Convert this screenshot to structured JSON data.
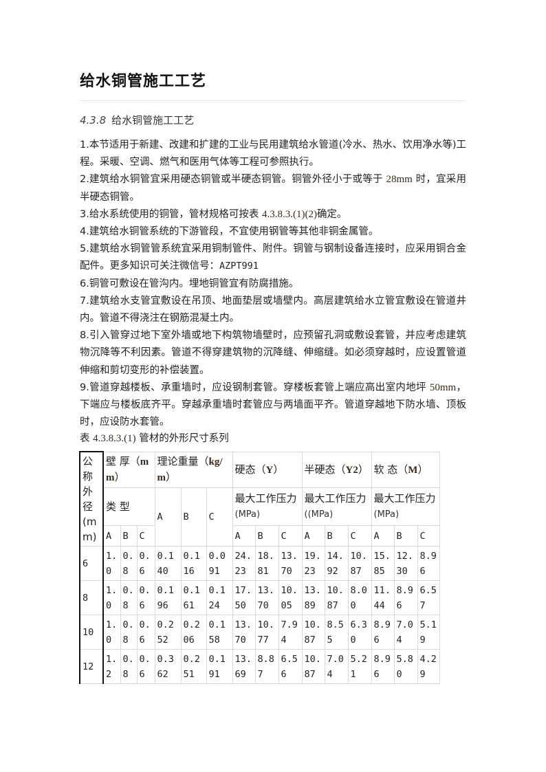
{
  "document": {
    "title": "给水铜管施工工艺",
    "section_number": "4.3.8",
    "section_title": "给水铜管施工工艺",
    "paragraphs": [
      {
        "prefix": "1.",
        "text": "本节适用于新建、改建和扩建的工业与民用建筑给水管道(冷水、热水、饮用净水等)工程。采暖、空调、燃气和医用气体等工程可参照执行。"
      },
      {
        "prefix": "2.",
        "text_a": "建筑给水铜管宜采用硬态铜管或半硬态铜管。铜管外径小于或等于 ",
        "latin": "28mm",
        "text_b": " 时，宜采用半硬态铜管。"
      },
      {
        "prefix": "3.",
        "text_a": "给水系统使用的铜管，管材规格可按表 ",
        "latin": "4.3.8.3.(1)(2)",
        "text_b": "确定。"
      },
      {
        "prefix": "4.",
        "text": "建筑给水铜管系统的下游管段，不宜使用钢管等其他非铜金属管。"
      },
      {
        "prefix": "5.",
        "text_a": "建筑给水铜管管系统宜采用铜制管件、附件。铜管与钢制设备连接时，应采用铜合金配件。更多知识可关注微信号：",
        "code": "AZPT991"
      },
      {
        "prefix": "6.",
        "text": "铜管可敷设在管沟内。埋地铜管宜有防腐措施。"
      },
      {
        "prefix": "7.",
        "text": "建筑给水支管宜敷设在吊顶、地面垫层或墙壁内。高层建筑给水立管宜敷设在管道井内。管道不得浇注在钢筋混凝土内。"
      },
      {
        "prefix": "8.",
        "text": "引入管穿过地下室外墙或地下构筑物墙壁时，应预留孔洞或敷设套管，并应考虑建筑物沉降等不利因素。管道不得穿建筑物的沉降缝、伸缩缝。如必须穿越时，应设置管道伸缩和剪切变形的补偿装置。"
      },
      {
        "prefix": "9.",
        "text_a": "管道穿越楼板、承重墙时，应设钢制套管。穿楼板套管上端应高出室内地坪 ",
        "latin": "50mm",
        "text_b": "，下端应与楼板底齐平。穿越承重墙时套管应与两墙面平齐。管道穿越地下防水墙、顶板时，应设防水套管。"
      }
    ],
    "table_caption_prefix": "表 ",
    "table_caption_num": "4.3.8.3.(1)",
    "table_caption_text": " 管材的外形尺寸系列"
  },
  "table": {
    "header": {
      "nominal_od": "公称外径(mm)",
      "wall_thickness": "壁 厚（mm）",
      "wall_thickness_unit_prefix": "壁 厚（",
      "wall_thickness_unit": "mm",
      "wall_thickness_suffix": "）",
      "weight_prefix": "理论重量（",
      "weight_unit": "kg/m",
      "weight_suffix": "）",
      "hard": "硬态（Y）",
      "hard_prefix": "硬态（",
      "hard_code": "Y",
      "half_hard_prefix": "半硬态（",
      "half_hard_code": "Y2",
      "soft_prefix": "软 态（",
      "soft_code": "M",
      "close_paren": "）",
      "type_label": "类 型",
      "pressure_hard_a": "最大工作压力",
      "pressure_hard_b": "(MPa)",
      "pressure_half_a": "最大工作压力",
      "pressure_half_b": "((MPa)",
      "pressure_soft_a": "最大工作压力",
      "pressure_soft_b": "(MPa)",
      "letters": [
        "A",
        "B",
        "C"
      ]
    },
    "rows": [
      {
        "od": "6",
        "wall": [
          "1.0",
          "0.8",
          "0.6"
        ],
        "weight": [
          "0.140",
          "0.116",
          "0.091"
        ],
        "hard": [
          "24.23",
          "18.81",
          "13.70"
        ],
        "half_hard": [
          "19.23",
          "14.92",
          "10.87"
        ],
        "soft": [
          "15.85",
          "12.30",
          "8.96"
        ]
      },
      {
        "od": "8",
        "wall": [
          "1.0",
          "0.8",
          "0.6"
        ],
        "weight": [
          "0.196",
          "0.161",
          "0.124"
        ],
        "hard": [
          "17.50",
          "13.70",
          "10.05"
        ],
        "half_hard": [
          "13.89",
          "10.87",
          "8.00"
        ],
        "soft": [
          "11.44",
          "8.96",
          "6.57"
        ]
      },
      {
        "od": "10",
        "wall": [
          "1.0",
          "0.8",
          "0.6"
        ],
        "weight": [
          "0.252",
          "0.206",
          "0.158"
        ],
        "hard": [
          "13.70",
          "10.77",
          "7.94"
        ],
        "half_hard": [
          "10.87",
          "8.55",
          "6.30"
        ],
        "soft": [
          "8.96",
          "7.04",
          "5.19"
        ]
      },
      {
        "od": "12",
        "wall": [
          "1.2",
          "0.8",
          "0.6"
        ],
        "weight": [
          "0.362",
          "0.251",
          "0.191"
        ],
        "hard": [
          "13.69",
          "8.87",
          "6.56"
        ],
        "half_hard": [
          "10.87",
          "7.04",
          "5.21"
        ],
        "soft": [
          "8.96",
          "5.80",
          "4.29"
        ]
      }
    ]
  }
}
